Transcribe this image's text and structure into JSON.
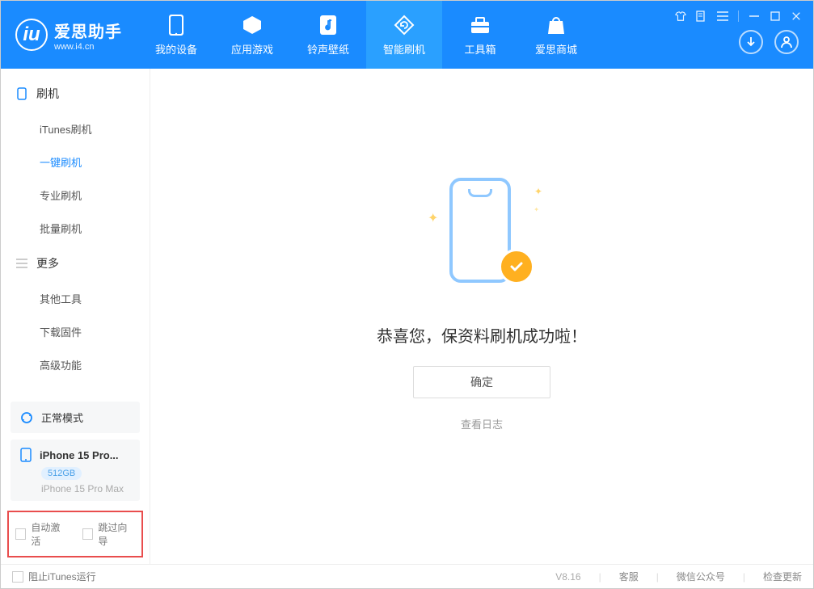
{
  "app": {
    "name": "爱思助手",
    "url": "www.i4.cn"
  },
  "nav": {
    "items": [
      {
        "label": "我的设备"
      },
      {
        "label": "应用游戏"
      },
      {
        "label": "铃声壁纸"
      },
      {
        "label": "智能刷机"
      },
      {
        "label": "工具箱"
      },
      {
        "label": "爱思商城"
      }
    ]
  },
  "sidebar": {
    "groups": [
      {
        "label": "刷机",
        "items": [
          {
            "label": "iTunes刷机"
          },
          {
            "label": "一键刷机"
          },
          {
            "label": "专业刷机"
          },
          {
            "label": "批量刷机"
          }
        ]
      },
      {
        "label": "更多",
        "items": [
          {
            "label": "其他工具"
          },
          {
            "label": "下载固件"
          },
          {
            "label": "高级功能"
          }
        ]
      }
    ],
    "status": "正常模式",
    "device": {
      "name": "iPhone 15 Pro...",
      "storage": "512GB",
      "model": "iPhone 15 Pro Max"
    },
    "checkboxes": {
      "auto_activate": "自动激活",
      "skip_guide": "跳过向导"
    }
  },
  "main": {
    "success_title": "恭喜您，保资料刷机成功啦！",
    "ok_label": "确定",
    "log_link": "查看日志"
  },
  "footer": {
    "prevent_itunes": "阻止iTunes运行",
    "version": "V8.16",
    "support": "客服",
    "wechat": "微信公众号",
    "check_update": "检查更新"
  }
}
